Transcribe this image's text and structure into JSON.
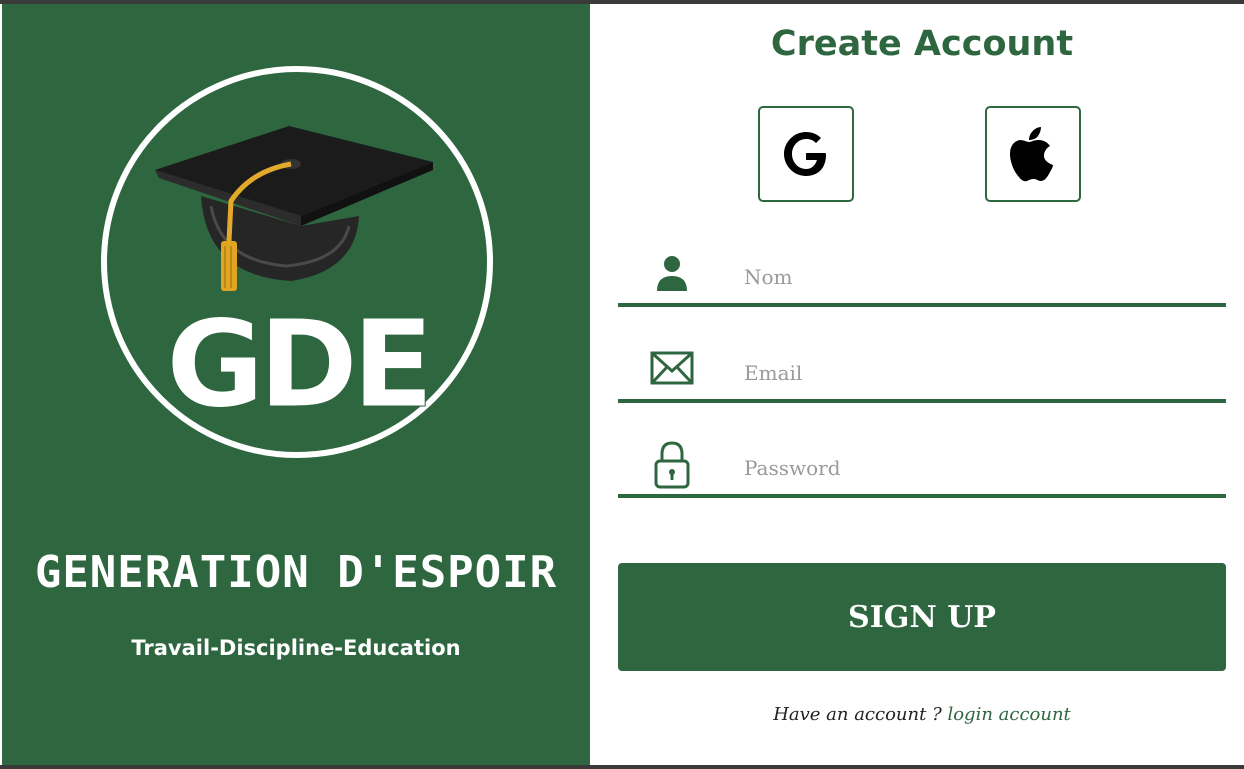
{
  "brand": {
    "logo_text": "GDE",
    "name": "GENERATION D'ESPOIR",
    "motto": "Travail-Discipline-Education"
  },
  "form": {
    "title": "Create Account",
    "social": [
      {
        "provider": "Google",
        "icon": "google-g-icon"
      },
      {
        "provider": "Apple",
        "icon": "apple-icon"
      }
    ],
    "fields": {
      "name": {
        "placeholder": "Nom",
        "value": "",
        "icon": "user-icon"
      },
      "email": {
        "placeholder": "Email",
        "value": "",
        "icon": "envelope-icon"
      },
      "password": {
        "placeholder": "Password",
        "value": "",
        "icon": "padlock-icon"
      }
    },
    "submit_label": "SIGN UP",
    "footer_text": "Have an account ? ",
    "footer_link": "login account"
  },
  "colors": {
    "brand_green": "#2e6640",
    "white": "#ffffff",
    "placeholder_gray": "#9a9a9a"
  }
}
